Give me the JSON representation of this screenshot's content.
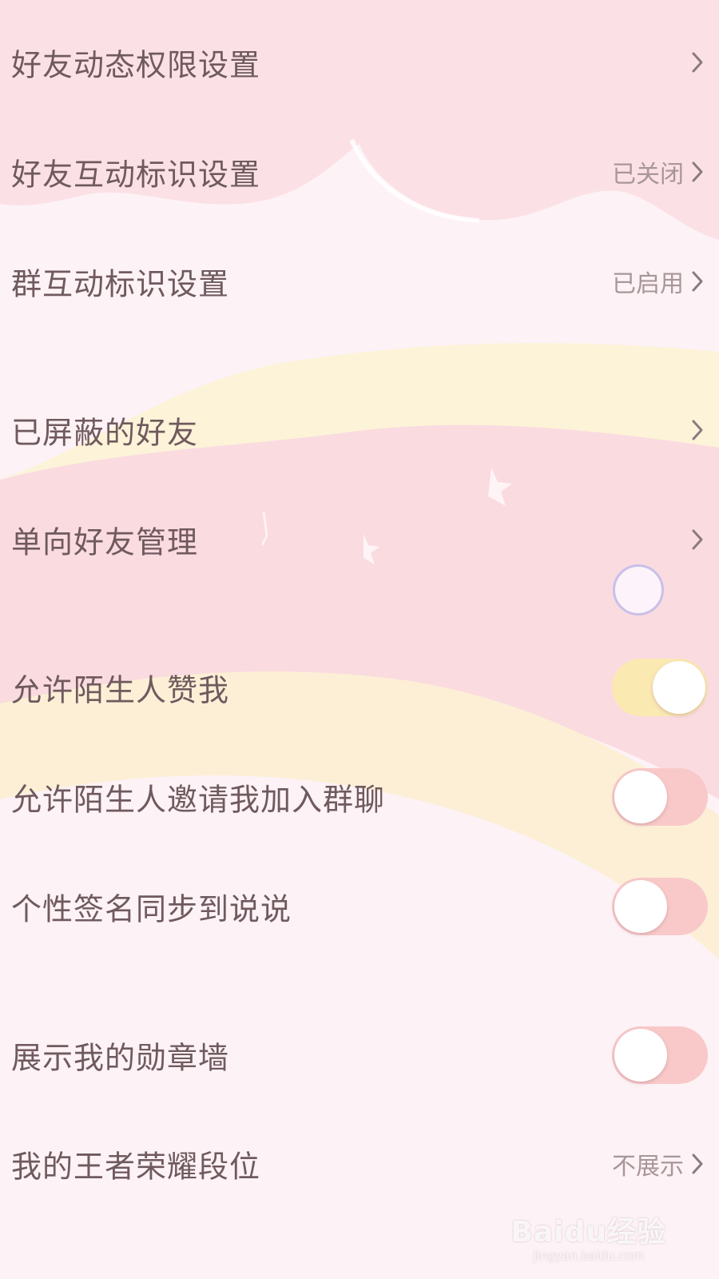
{
  "settings": [
    {
      "label": "好友动态权限设置",
      "value": "",
      "control": "chevron"
    },
    {
      "label": "好友互动标识设置",
      "value": "已关闭",
      "control": "chevron"
    },
    {
      "label": "群互动标识设置",
      "value": "已启用",
      "control": "chevron"
    },
    {
      "label": "已屏蔽的好友",
      "value": "",
      "control": "chevron"
    },
    {
      "label": "单向好友管理",
      "value": "",
      "control": "chevron"
    },
    {
      "label": "允许陌生人赞我",
      "control": "toggle",
      "on": true
    },
    {
      "label": "允许陌生人邀请我加入群聊",
      "control": "toggle",
      "on": false
    },
    {
      "label": "个性签名同步到说说",
      "control": "toggle",
      "on": false
    },
    {
      "label": "展示我的勋章墙",
      "control": "toggle",
      "on": false
    },
    {
      "label": "我的王者荣耀段位",
      "value": "不展示",
      "control": "chevron"
    }
  ],
  "icons": {
    "chevron": "chevron-right-icon",
    "floating": "floating-circle-icon"
  },
  "colors": {
    "text": "#6f5a5e",
    "value_text": "#a89698",
    "toggle_on": "#fbe9b2",
    "toggle_off": "#f9c9c9",
    "knob": "#ffffff"
  },
  "watermark": {
    "logo": "Baidu经验",
    "url": "jingyan.baidu.com"
  }
}
